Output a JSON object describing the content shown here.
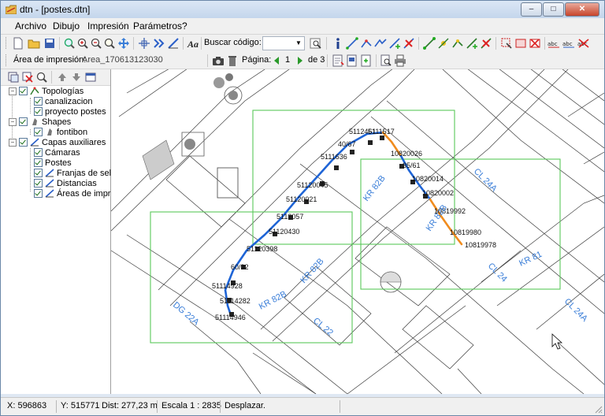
{
  "window": {
    "title": "dtn - [postes.dtn]",
    "minimize": "‒",
    "maximize": "□",
    "close": "✕"
  },
  "menu": {
    "items": [
      "Archivo",
      "Dibujo",
      "Impresión",
      "Parámetros",
      "?"
    ]
  },
  "toolbar": {
    "search_label": "Buscar código:",
    "search_value": ""
  },
  "printbar": {
    "area_label": "Área de impresión:",
    "area_value": "Area_170613123030",
    "page_label": "Página:",
    "page_current": "1",
    "page_of": "de 3"
  },
  "tree": {
    "nodes": [
      {
        "label": "Topologías"
      },
      {
        "label": "canalizacion"
      },
      {
        "label": "proyecto postes"
      },
      {
        "label": "Shapes"
      },
      {
        "label": "fontibon"
      },
      {
        "label": "Capas auxiliares"
      },
      {
        "label": "Cámaras"
      },
      {
        "label": "Postes"
      },
      {
        "label": "Franjas de selección"
      },
      {
        "label": "Distancias"
      },
      {
        "label": "Áreas de impresión"
      }
    ]
  },
  "map": {
    "street_labels": [
      "DG 22A",
      "KR 82B",
      "KR 82B",
      "KR 82B",
      "KR 82B",
      "CL 22",
      "CL 24A",
      "CL 24A",
      "KR 81",
      "CL 24"
    ],
    "pole_labels": [
      "5112461",
      "5111517",
      "40/67",
      "5111636",
      "51120045",
      "51120021",
      "5112057",
      "51120430",
      "51120398",
      "60/92",
      "51114928",
      "51114282",
      "51114946",
      "10820026",
      "35/61",
      "10820014",
      "10820002",
      "10819992",
      "10819980",
      "10819978"
    ],
    "colors": {
      "print_area": "#5ac85a",
      "route_blue": "#1e64d6",
      "route_orange": "#f08c1e",
      "street_label": "#3a7ed8"
    }
  },
  "status": {
    "x": "X: 596863",
    "y": "Y: 515771",
    "dist": "Dist: 277,23 m",
    "scale": "Escala  1 : 2835",
    "mode": "Desplazar."
  }
}
